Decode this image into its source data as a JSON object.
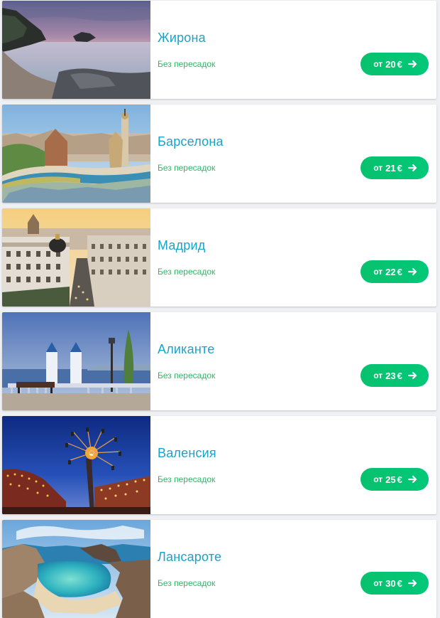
{
  "destinations": [
    {
      "city": "Жирона",
      "direct": "Без пересадок",
      "price_prefix": "от",
      "price": "20",
      "currency": "€",
      "image": "girona-coast-sunset-photo"
    },
    {
      "city": "Барселона",
      "direct": "Без пересадок",
      "price_prefix": "от",
      "price": "21",
      "currency": "€",
      "image": "barcelona-park-guell-photo"
    },
    {
      "city": "Мадрид",
      "direct": "Без пересадок",
      "price_prefix": "от",
      "price": "22",
      "currency": "€",
      "image": "madrid-gran-via-photo"
    },
    {
      "city": "Аликанте",
      "direct": "Без пересадок",
      "price_prefix": "от",
      "price": "23",
      "currency": "€",
      "image": "alicante-promenade-photo"
    },
    {
      "city": "Валенсия",
      "direct": "Без пересадок",
      "price_prefix": "от",
      "price": "25",
      "currency": "€",
      "image": "valencia-fair-night-photo"
    },
    {
      "city": "Лансароте",
      "direct": "Без пересадок",
      "price_prefix": "от",
      "price": "30",
      "currency": "€",
      "image": "lanzarote-beach-cove-photo"
    }
  ],
  "colors": {
    "city": "#1aa3c9",
    "direct": "#36b36a",
    "button": "#09c16e"
  }
}
